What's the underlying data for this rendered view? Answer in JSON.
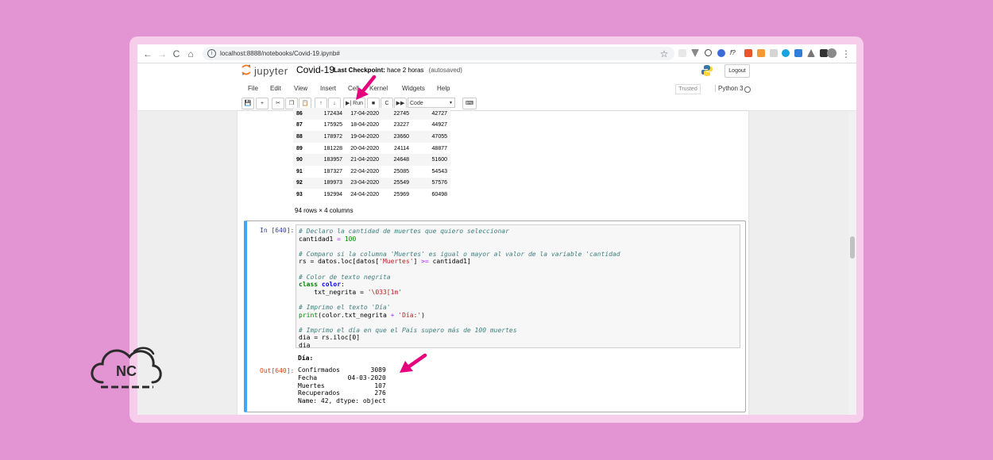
{
  "browser": {
    "url": "localhost:8888/notebooks/Covid-19.ipynb#",
    "back_label": "←",
    "forward_label": "→",
    "reload_label": "C",
    "home_label": "⌂",
    "info_label": "i",
    "star_label": "☆",
    "menu_label": "⋮",
    "ext_f_label": "f?"
  },
  "header": {
    "logo_text": "jupyter",
    "title": "Covid-19",
    "checkpoint_label": "Last Checkpoint:",
    "checkpoint_time": "hace 2 horas",
    "autosaved": "(autosaved)",
    "logout_label": "Logout"
  },
  "menu": [
    "File",
    "Edit",
    "View",
    "Insert",
    "Cell",
    "Kernel",
    "Widgets",
    "Help"
  ],
  "status": {
    "trusted": "Trusted",
    "kernel": "Python 3"
  },
  "toolbar": {
    "save_icon": "💾",
    "add_icon": "+",
    "cut_icon": "✂",
    "copy_icon": "❐",
    "paste_icon": "📋",
    "up_icon": "↑",
    "down_icon": "↓",
    "run_label": "▶| Run",
    "stop_icon": "■",
    "restart_icon": "C",
    "fast_forward_icon": "▶▶",
    "cell_type": "Code",
    "dropdown_caret": "▾",
    "keyboard_icon": "⌨"
  },
  "dataframe": {
    "rows": [
      [
        "86",
        "172434",
        "17-04-2020",
        "22745",
        "42727"
      ],
      [
        "87",
        "175925",
        "18-04-2020",
        "23227",
        "44927"
      ],
      [
        "88",
        "178972",
        "19-04-2020",
        "23660",
        "47055"
      ],
      [
        "89",
        "181228",
        "20-04-2020",
        "24114",
        "48877"
      ],
      [
        "90",
        "183957",
        "21-04-2020",
        "24648",
        "51600"
      ],
      [
        "91",
        "187327",
        "22-04-2020",
        "25085",
        "54543"
      ],
      [
        "92",
        "189973",
        "23-04-2020",
        "25549",
        "57576"
      ],
      [
        "93",
        "192994",
        "24-04-2020",
        "25969",
        "60498"
      ]
    ],
    "shape_note": "94 rows × 4 columns"
  },
  "cell": {
    "in_prompt": "In [640]:",
    "code": {
      "c1": "# Declaro la cantidad de muertes que quiero seleccionar",
      "l1_var": "cantidad1",
      "l1_op": " = ",
      "l1_val": "100",
      "c2": "# Comparo si la columna 'Muertes' es igual o mayor al valor de la variable 'cantidad",
      "l2_a": "rs = datos.loc[datos[",
      "l2_str": "'Muertes'",
      "l2_b": "] ",
      "l2_op": ">=",
      "l2_c": " cantidad1]",
      "c3": "# Color de texto negrita",
      "l3_kw": "class",
      "l3_name": "color",
      "l3_colon": ":",
      "l4_a": "    txt_negrita = ",
      "l4_str": "'\\033[1m'",
      "c4": "# Imprimo el texto 'Día'",
      "l5_fn": "print",
      "l5_a": "(color.txt_negrita ",
      "l5_op": "+",
      "l5_str": " 'Día:'",
      "l5_b": ")",
      "c5": "# Imprimo el día en que el País supero más de 100 muertes",
      "l6": "dia = rs.iloc[0]",
      "l7": "dia"
    },
    "stdout": "Día:",
    "out_prompt": "Out[640]:",
    "output": "Confirmados        3089\nFecha        04-03-2020\nMuertes             107\nRecuperados         276\nName: 42, dtype: object"
  },
  "brand": {
    "nc_text": "NC"
  },
  "colors": {
    "background": "#e394d3",
    "arrow": "#e6007e",
    "cell_border": "#42a5f5"
  }
}
